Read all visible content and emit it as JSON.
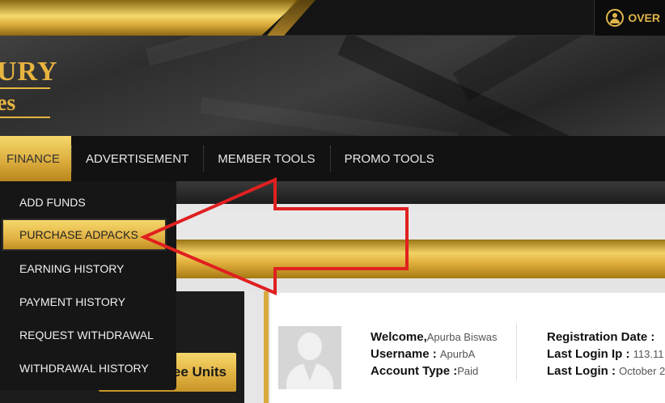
{
  "header": {
    "logo_line1": "URY",
    "logo_line2": "es",
    "overview_label": "OVER",
    "overview_icon": "user-circle-icon"
  },
  "nav": {
    "items": [
      {
        "label": "FINANCE",
        "active": true
      },
      {
        "label": "ADVERTISEMENT"
      },
      {
        "label": "MEMBER TOOLS"
      },
      {
        "label": "PROMO TOOLS"
      }
    ]
  },
  "finance_menu": {
    "items": [
      {
        "label": "ADD FUNDS"
      },
      {
        "label": "PURCHASE ADPACKS",
        "highlighted": true
      },
      {
        "label": "EARNING HISTORY"
      },
      {
        "label": "PAYMENT HISTORY"
      },
      {
        "label": "REQUEST WITHDRAWAL"
      },
      {
        "label": "WITHDRAWAL HISTORY"
      }
    ]
  },
  "units_button": {
    "label": "ee Units"
  },
  "profile": {
    "welcome_label": "Welcome,",
    "welcome_value": "Apurba Biswas",
    "username_label": "Username :",
    "username_value": "ApurbA",
    "account_type_label": "Account Type :",
    "account_type_value": "Paid",
    "registration_label": "Registration Date :",
    "last_ip_label": "Last Login Ip :",
    "last_ip_value": "113.11",
    "last_login_label": "Last Login :",
    "last_login_value": "October 2"
  },
  "colors": {
    "gold": "#e0b54a",
    "dark": "#141414",
    "annotation_red": "#e02020"
  }
}
